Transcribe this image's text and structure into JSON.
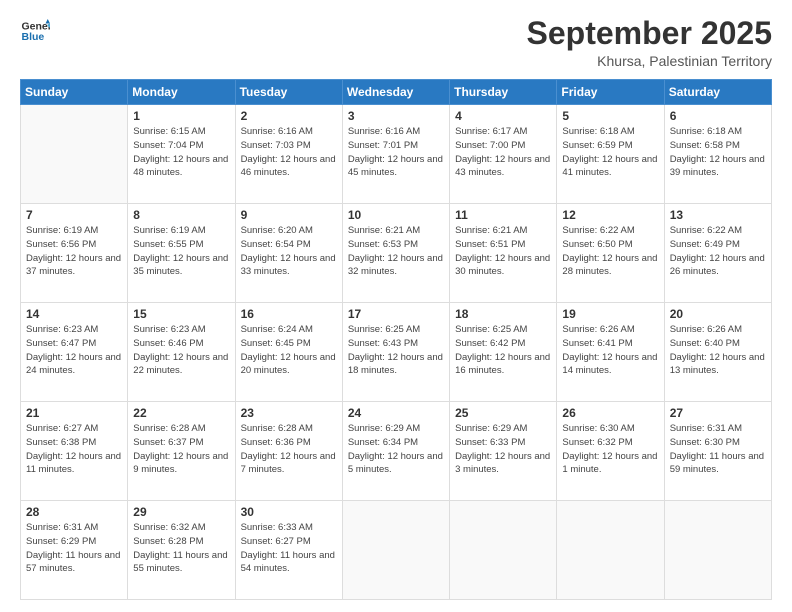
{
  "header": {
    "logo_general": "General",
    "logo_blue": "Blue",
    "month_title": "September 2025",
    "location": "Khursa, Palestinian Territory"
  },
  "days_of_week": [
    "Sunday",
    "Monday",
    "Tuesday",
    "Wednesday",
    "Thursday",
    "Friday",
    "Saturday"
  ],
  "weeks": [
    [
      {
        "day": "",
        "sunrise": "",
        "sunset": "",
        "daylight": "",
        "empty": true
      },
      {
        "day": "1",
        "sunrise": "Sunrise: 6:15 AM",
        "sunset": "Sunset: 7:04 PM",
        "daylight": "Daylight: 12 hours and 48 minutes."
      },
      {
        "day": "2",
        "sunrise": "Sunrise: 6:16 AM",
        "sunset": "Sunset: 7:03 PM",
        "daylight": "Daylight: 12 hours and 46 minutes."
      },
      {
        "day": "3",
        "sunrise": "Sunrise: 6:16 AM",
        "sunset": "Sunset: 7:01 PM",
        "daylight": "Daylight: 12 hours and 45 minutes."
      },
      {
        "day": "4",
        "sunrise": "Sunrise: 6:17 AM",
        "sunset": "Sunset: 7:00 PM",
        "daylight": "Daylight: 12 hours and 43 minutes."
      },
      {
        "day": "5",
        "sunrise": "Sunrise: 6:18 AM",
        "sunset": "Sunset: 6:59 PM",
        "daylight": "Daylight: 12 hours and 41 minutes."
      },
      {
        "day": "6",
        "sunrise": "Sunrise: 6:18 AM",
        "sunset": "Sunset: 6:58 PM",
        "daylight": "Daylight: 12 hours and 39 minutes."
      }
    ],
    [
      {
        "day": "7",
        "sunrise": "Sunrise: 6:19 AM",
        "sunset": "Sunset: 6:56 PM",
        "daylight": "Daylight: 12 hours and 37 minutes."
      },
      {
        "day": "8",
        "sunrise": "Sunrise: 6:19 AM",
        "sunset": "Sunset: 6:55 PM",
        "daylight": "Daylight: 12 hours and 35 minutes."
      },
      {
        "day": "9",
        "sunrise": "Sunrise: 6:20 AM",
        "sunset": "Sunset: 6:54 PM",
        "daylight": "Daylight: 12 hours and 33 minutes."
      },
      {
        "day": "10",
        "sunrise": "Sunrise: 6:21 AM",
        "sunset": "Sunset: 6:53 PM",
        "daylight": "Daylight: 12 hours and 32 minutes."
      },
      {
        "day": "11",
        "sunrise": "Sunrise: 6:21 AM",
        "sunset": "Sunset: 6:51 PM",
        "daylight": "Daylight: 12 hours and 30 minutes."
      },
      {
        "day": "12",
        "sunrise": "Sunrise: 6:22 AM",
        "sunset": "Sunset: 6:50 PM",
        "daylight": "Daylight: 12 hours and 28 minutes."
      },
      {
        "day": "13",
        "sunrise": "Sunrise: 6:22 AM",
        "sunset": "Sunset: 6:49 PM",
        "daylight": "Daylight: 12 hours and 26 minutes."
      }
    ],
    [
      {
        "day": "14",
        "sunrise": "Sunrise: 6:23 AM",
        "sunset": "Sunset: 6:47 PM",
        "daylight": "Daylight: 12 hours and 24 minutes."
      },
      {
        "day": "15",
        "sunrise": "Sunrise: 6:23 AM",
        "sunset": "Sunset: 6:46 PM",
        "daylight": "Daylight: 12 hours and 22 minutes."
      },
      {
        "day": "16",
        "sunrise": "Sunrise: 6:24 AM",
        "sunset": "Sunset: 6:45 PM",
        "daylight": "Daylight: 12 hours and 20 minutes."
      },
      {
        "day": "17",
        "sunrise": "Sunrise: 6:25 AM",
        "sunset": "Sunset: 6:43 PM",
        "daylight": "Daylight: 12 hours and 18 minutes."
      },
      {
        "day": "18",
        "sunrise": "Sunrise: 6:25 AM",
        "sunset": "Sunset: 6:42 PM",
        "daylight": "Daylight: 12 hours and 16 minutes."
      },
      {
        "day": "19",
        "sunrise": "Sunrise: 6:26 AM",
        "sunset": "Sunset: 6:41 PM",
        "daylight": "Daylight: 12 hours and 14 minutes."
      },
      {
        "day": "20",
        "sunrise": "Sunrise: 6:26 AM",
        "sunset": "Sunset: 6:40 PM",
        "daylight": "Daylight: 12 hours and 13 minutes."
      }
    ],
    [
      {
        "day": "21",
        "sunrise": "Sunrise: 6:27 AM",
        "sunset": "Sunset: 6:38 PM",
        "daylight": "Daylight: 12 hours and 11 minutes."
      },
      {
        "day": "22",
        "sunrise": "Sunrise: 6:28 AM",
        "sunset": "Sunset: 6:37 PM",
        "daylight": "Daylight: 12 hours and 9 minutes."
      },
      {
        "day": "23",
        "sunrise": "Sunrise: 6:28 AM",
        "sunset": "Sunset: 6:36 PM",
        "daylight": "Daylight: 12 hours and 7 minutes."
      },
      {
        "day": "24",
        "sunrise": "Sunrise: 6:29 AM",
        "sunset": "Sunset: 6:34 PM",
        "daylight": "Daylight: 12 hours and 5 minutes."
      },
      {
        "day": "25",
        "sunrise": "Sunrise: 6:29 AM",
        "sunset": "Sunset: 6:33 PM",
        "daylight": "Daylight: 12 hours and 3 minutes."
      },
      {
        "day": "26",
        "sunrise": "Sunrise: 6:30 AM",
        "sunset": "Sunset: 6:32 PM",
        "daylight": "Daylight: 12 hours and 1 minute."
      },
      {
        "day": "27",
        "sunrise": "Sunrise: 6:31 AM",
        "sunset": "Sunset: 6:30 PM",
        "daylight": "Daylight: 11 hours and 59 minutes."
      }
    ],
    [
      {
        "day": "28",
        "sunrise": "Sunrise: 6:31 AM",
        "sunset": "Sunset: 6:29 PM",
        "daylight": "Daylight: 11 hours and 57 minutes."
      },
      {
        "day": "29",
        "sunrise": "Sunrise: 6:32 AM",
        "sunset": "Sunset: 6:28 PM",
        "daylight": "Daylight: 11 hours and 55 minutes."
      },
      {
        "day": "30",
        "sunrise": "Sunrise: 6:33 AM",
        "sunset": "Sunset: 6:27 PM",
        "daylight": "Daylight: 11 hours and 54 minutes."
      },
      {
        "day": "",
        "sunrise": "",
        "sunset": "",
        "daylight": "",
        "empty": true
      },
      {
        "day": "",
        "sunrise": "",
        "sunset": "",
        "daylight": "",
        "empty": true
      },
      {
        "day": "",
        "sunrise": "",
        "sunset": "",
        "daylight": "",
        "empty": true
      },
      {
        "day": "",
        "sunrise": "",
        "sunset": "",
        "daylight": "",
        "empty": true
      }
    ]
  ]
}
